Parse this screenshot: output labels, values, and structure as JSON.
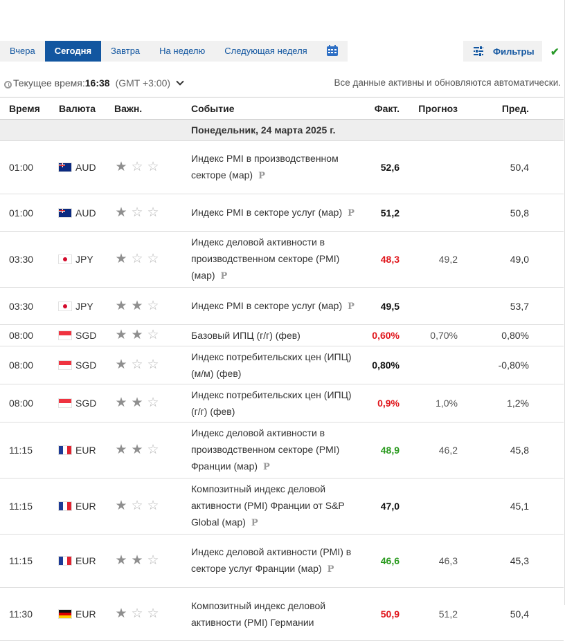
{
  "tabs": [
    {
      "label": "Вчера",
      "active": false
    },
    {
      "label": "Сегодня",
      "active": true
    },
    {
      "label": "Завтра",
      "active": false
    },
    {
      "label": "На неделю",
      "active": false
    },
    {
      "label": "Следующая неделя",
      "active": false
    }
  ],
  "calendar_icon": "calendar-icon",
  "filters": {
    "label": "Фильтры",
    "icon": "sliders-icon"
  },
  "status_check_icon": "checkmark-icon",
  "time_bar": {
    "label": "Текущее время:",
    "time": "16:38",
    "timezone": "(GMT +3:00)",
    "auto_note": "Все данные активны и обновляются автоматически."
  },
  "table": {
    "headers": {
      "time": "Время",
      "currency": "Валюта",
      "importance": "Важн.",
      "event": "Событие",
      "actual": "Факт.",
      "forecast": "Прогноз",
      "previous": "Пред."
    },
    "day_label": "Понедельник, 24 марта 2025 г.",
    "rows": [
      {
        "time": "01:00",
        "flag": "aud",
        "currency": "AUD",
        "stars": 1,
        "event": "Индекс PMI в производственном секторе (мар)",
        "preliminary": true,
        "actual": "52,6",
        "actual_color": "black",
        "forecast": "",
        "previous": "50,4"
      },
      {
        "time": "01:00",
        "flag": "aud",
        "currency": "AUD",
        "stars": 1,
        "event": "Индекс PMI в секторе услуг (мар)",
        "preliminary": true,
        "actual": "51,2",
        "actual_color": "black",
        "forecast": "",
        "previous": "50,8"
      },
      {
        "time": "03:30",
        "flag": "jpy",
        "currency": "JPY",
        "stars": 1,
        "event": "Индекс деловой активности в производственном секторе (PMI) (мар)",
        "preliminary": true,
        "actual": "48,3",
        "actual_color": "red",
        "forecast": "49,2",
        "previous": "49,0"
      },
      {
        "time": "03:30",
        "flag": "jpy",
        "currency": "JPY",
        "stars": 2,
        "event": "Индекс PMI в секторе услуг (мар)",
        "preliminary": true,
        "actual": "49,5",
        "actual_color": "black",
        "forecast": "",
        "previous": "53,7"
      },
      {
        "time": "08:00",
        "flag": "sgd",
        "currency": "SGD",
        "stars": 2,
        "event": "Базовый ИПЦ (г/г) (фев)",
        "preliminary": false,
        "actual": "0,60%",
        "actual_color": "red",
        "forecast": "0,70%",
        "previous": "0,80%"
      },
      {
        "time": "08:00",
        "flag": "sgd",
        "currency": "SGD",
        "stars": 1,
        "event": "Индекс потребительских цен (ИПЦ) (м/м) (фев)",
        "preliminary": false,
        "actual": "0,80%",
        "actual_color": "black",
        "forecast": "",
        "previous": "-0,80%"
      },
      {
        "time": "08:00",
        "flag": "sgd",
        "currency": "SGD",
        "stars": 2,
        "event": "Индекс потребительских цен (ИПЦ) (г/г) (фев)",
        "preliminary": false,
        "actual": "0,9%",
        "actual_color": "red",
        "forecast": "1,0%",
        "previous": "1,2%"
      },
      {
        "time": "11:15",
        "flag": "eur",
        "currency": "EUR",
        "stars": 2,
        "event": "Индекс деловой активности в производственном секторе (PMI) Франции (мар)",
        "preliminary": true,
        "actual": "48,9",
        "actual_color": "green",
        "forecast": "46,2",
        "previous": "45,8"
      },
      {
        "time": "11:15",
        "flag": "eur",
        "currency": "EUR",
        "stars": 1,
        "event": "Композитный индекс деловой активности (PMI) Франции от S&P Global (мар)",
        "preliminary": true,
        "actual": "47,0",
        "actual_color": "black",
        "forecast": "",
        "previous": "45,1"
      },
      {
        "time": "11:15",
        "flag": "eur",
        "currency": "EUR",
        "stars": 2,
        "event": "Индекс деловой активности (PMI) в секторе услуг Франции (мар)",
        "preliminary": true,
        "actual": "46,6",
        "actual_color": "green",
        "forecast": "46,3",
        "previous": "45,3"
      },
      {
        "time": "11:30",
        "flag": "deu",
        "currency": "EUR",
        "stars": 1,
        "event": "Композитный индекс деловой активности (PMI) Германии",
        "preliminary": false,
        "actual": "50,9",
        "actual_color": "red",
        "forecast": "51,2",
        "previous": "50,4"
      }
    ]
  }
}
